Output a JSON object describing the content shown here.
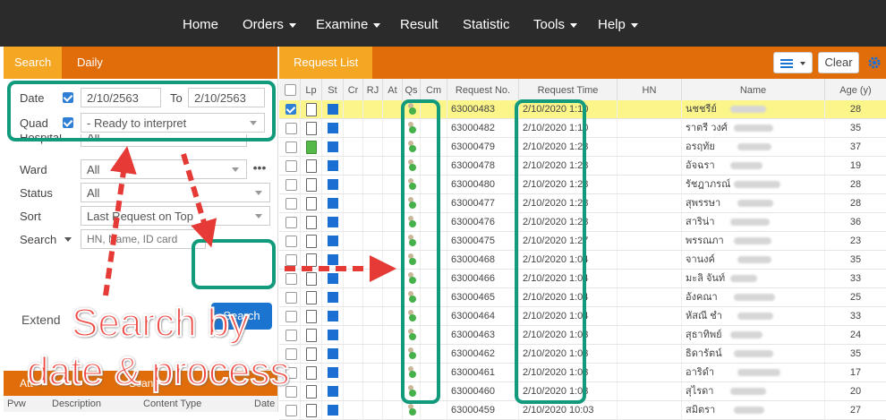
{
  "topnav": {
    "items": [
      {
        "label": "Home",
        "dropdown": false
      },
      {
        "label": "Orders",
        "dropdown": true
      },
      {
        "label": "Examine",
        "dropdown": true
      },
      {
        "label": "Result",
        "dropdown": false
      },
      {
        "label": "Statistic",
        "dropdown": false
      },
      {
        "label": "Tools",
        "dropdown": true
      },
      {
        "label": "Help",
        "dropdown": true
      }
    ]
  },
  "left": {
    "tabs": [
      "Search",
      "Daily"
    ],
    "active_tab": "Search",
    "date": {
      "label": "Date",
      "from": "2/10/2563",
      "to_label": "To",
      "to": "2/10/2563",
      "checked": true
    },
    "quad": {
      "label": "Quad",
      "value": "- Ready to interpret",
      "checked": true
    },
    "hospital": {
      "label": "Hospital",
      "value": "All"
    },
    "ward": {
      "label": "Ward",
      "value": "All"
    },
    "status": {
      "label": "Status",
      "value": "All"
    },
    "sort": {
      "label": "Sort",
      "value": "Last Request on Top"
    },
    "search": {
      "label": "Search",
      "placeholder": "HN, Name, ID card"
    },
    "extend_label": "Extend",
    "search_button": "Search",
    "bottom_tabs": [
      "Att",
      "Scan"
    ],
    "bottom_headers": [
      "Pvw",
      "Description",
      "Content Type",
      "Date"
    ]
  },
  "right": {
    "tab": "Request List",
    "clear_label": "Clear",
    "columns": [
      "Lp",
      "St",
      "Cr",
      "RJ",
      "At",
      "Qs",
      "Cm",
      "Request No.",
      "Request Time",
      "HN",
      "Name",
      "Age (y)"
    ],
    "rows": [
      {
        "no": "63000483",
        "time": "2/10/2020 1:10",
        "name": "นชชรีย์",
        "age": "28",
        "selected": true,
        "green_doc": false
      },
      {
        "no": "63000482",
        "time": "2/10/2020 1:10",
        "name": "ราตรี วงศ์",
        "age": "35",
        "selected": false,
        "green_doc": false
      },
      {
        "no": "63000479",
        "time": "2/10/2020 1:28",
        "name": "อรฤทัย",
        "age": "37",
        "selected": false,
        "green_doc": true
      },
      {
        "no": "63000478",
        "time": "2/10/2020 1:28",
        "name": "อัจฉรา",
        "age": "19",
        "selected": false,
        "green_doc": false
      },
      {
        "no": "63000480",
        "time": "2/10/2020 1:28",
        "name": "รัชฎาภรณ์",
        "age": "28",
        "selected": false,
        "green_doc": false
      },
      {
        "no": "63000477",
        "time": "2/10/2020 1:28",
        "name": "สุพรรษา",
        "age": "28",
        "selected": false,
        "green_doc": false
      },
      {
        "no": "63000476",
        "time": "2/10/2020 1:28",
        "name": "สาริน่า",
        "age": "36",
        "selected": false,
        "green_doc": false
      },
      {
        "no": "63000475",
        "time": "2/10/2020 1:27",
        "name": "พรรณภา",
        "age": "23",
        "selected": false,
        "green_doc": false
      },
      {
        "no": "63000468",
        "time": "2/10/2020 1:04",
        "name": "จานงค์",
        "age": "35",
        "selected": false,
        "green_doc": false
      },
      {
        "no": "63000466",
        "time": "2/10/2020 1:04",
        "name": "มะลิ จันท์",
        "age": "33",
        "selected": false,
        "green_doc": false
      },
      {
        "no": "63000465",
        "time": "2/10/2020 1:04",
        "name": "อังคณา",
        "age": "25",
        "selected": false,
        "green_doc": false
      },
      {
        "no": "63000464",
        "time": "2/10/2020 1:04",
        "name": "หัสณี ชำ",
        "age": "33",
        "selected": false,
        "green_doc": false
      },
      {
        "no": "63000463",
        "time": "2/10/2020 1:03",
        "name": "สุธาทิพย์",
        "age": "24",
        "selected": false,
        "green_doc": false
      },
      {
        "no": "63000462",
        "time": "2/10/2020 1:03",
        "name": "ธิดารัตน์",
        "age": "35",
        "selected": false,
        "green_doc": false
      },
      {
        "no": "63000461",
        "time": "2/10/2020 1:03",
        "name": "อาริดำ",
        "age": "17",
        "selected": false,
        "green_doc": false
      },
      {
        "no": "63000460",
        "time": "2/10/2020 1:03",
        "name": "สุไรดา",
        "age": "20",
        "selected": false,
        "green_doc": false
      },
      {
        "no": "63000459",
        "time": "2/10/2020 10:03",
        "name": "สมิตรา",
        "age": "27",
        "selected": false,
        "green_doc": false
      }
    ]
  },
  "annotation": {
    "line1": "Search by",
    "line2": "date & process"
  },
  "colors": {
    "topbar": "#2b2b2b",
    "tabbar": "#e06d0a",
    "active_tab": "#f5a623",
    "highlight": "#119b7c",
    "annotation": "#ef4a43",
    "primary_button": "#1b75d0"
  }
}
